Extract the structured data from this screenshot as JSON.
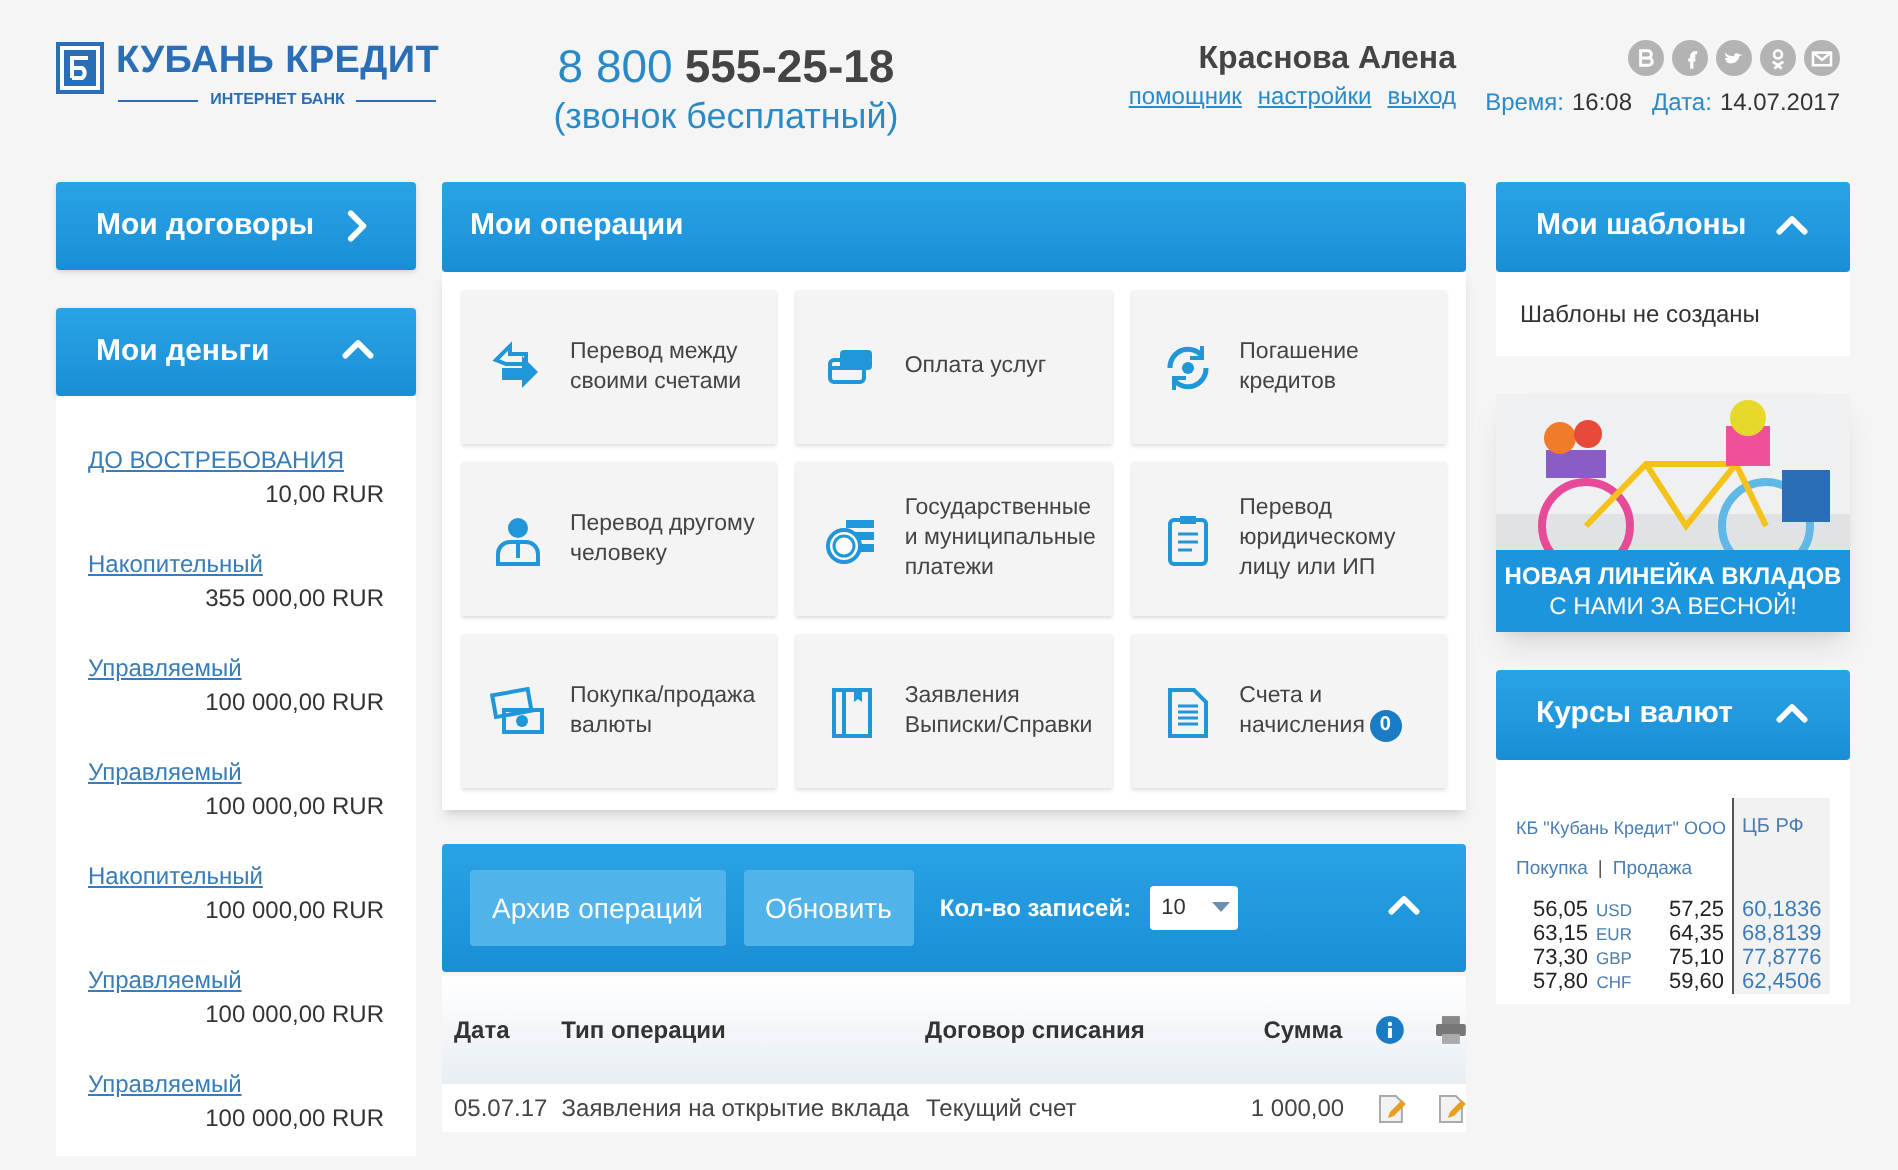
{
  "header": {
    "bank_name": "КУБАНЬ КРЕДИТ",
    "bank_subtitle": "ИНТЕРНЕТ БАНК",
    "phone_prefix": "8 800",
    "phone_number": "555-25-18",
    "phone_note": "(звонок бесплатный)",
    "user_name": "Краснова Алена",
    "user_links": [
      "помощник",
      "настройки",
      "выход"
    ],
    "time_label": "Время:",
    "time": "16:08",
    "date_label": "Дата:",
    "date": "14.07.2017"
  },
  "contracts_panel": {
    "title": "Мои договоры",
    "expanded": false
  },
  "money_panel": {
    "title": "Мои деньги",
    "expanded": true,
    "accounts": [
      {
        "name": "ДО ВОСТРЕБОВАНИЯ",
        "amount": "10,00 RUR"
      },
      {
        "name": "Накопительный",
        "amount": "355 000,00 RUR"
      },
      {
        "name": "Управляемый",
        "amount": "100 000,00 RUR"
      },
      {
        "name": "Управляемый",
        "amount": "100 000,00 RUR"
      },
      {
        "name": "Накопительный",
        "amount": "100 000,00 RUR"
      },
      {
        "name": "Управляемый",
        "amount": "100 000,00 RUR"
      },
      {
        "name": "Управляемый",
        "amount": "100 000,00 RUR"
      }
    ]
  },
  "operations_panel": {
    "title": "Мои операции",
    "tiles": [
      {
        "label": "Перевод между своими счетами"
      },
      {
        "label": "Оплата услуг"
      },
      {
        "label": "Погашение кредитов"
      },
      {
        "label": "Перевод другому человеку"
      },
      {
        "label": "Государственные и муниципальные платежи"
      },
      {
        "label": "Перевод юридическому лицу или ИП"
      },
      {
        "label": "Покупка/продажа валюты"
      },
      {
        "label": "Заявления Выписки/Справки"
      },
      {
        "label": "Счета и начисления",
        "badge": "0"
      }
    ]
  },
  "archive_panel": {
    "buttons": [
      "Архив операций",
      "Обновить"
    ],
    "records_label": "Кол-во записей:",
    "records_value": "10",
    "expanded": true,
    "table": {
      "columns": [
        "Дата",
        "Тип операции",
        "Договор списания",
        "Сумма"
      ],
      "rows": [
        {
          "date": "05.07.17",
          "type": "Заявления на открытие вклада",
          "account": "Текущий счет",
          "amount": "1 000,00"
        }
      ]
    }
  },
  "templates_panel": {
    "title": "Мои шаблоны",
    "expanded": true,
    "empty_text": "Шаблоны не созданы"
  },
  "banner": {
    "kind": "picture",
    "line_1": "НОВАЯ ЛИНЕЙКА ВКЛАДОВ",
    "line_2": "С НАМИ ЗА ВЕСНОЙ!"
  },
  "rates_panel": {
    "title": "Курсы валют",
    "expanded": true,
    "bank_label": "КБ \"Кубань Кредит\" ООО",
    "cb_label": "ЦБ РФ",
    "buy_label": "Покупка",
    "separator": "|",
    "sell_label": "Продажа",
    "rows": [
      {
        "buy": "56,05",
        "code": "USD",
        "sell": "57,25",
        "cb": "60,1836"
      },
      {
        "buy": "63,15",
        "code": "EUR",
        "sell": "64,35",
        "cb": "68,8139"
      },
      {
        "buy": "73,30",
        "code": "GBP",
        "sell": "75,10",
        "cb": "77,8776"
      },
      {
        "buy": "57,80",
        "code": "CHF",
        "sell": "59,60",
        "cb": "62,4506"
      }
    ]
  }
}
